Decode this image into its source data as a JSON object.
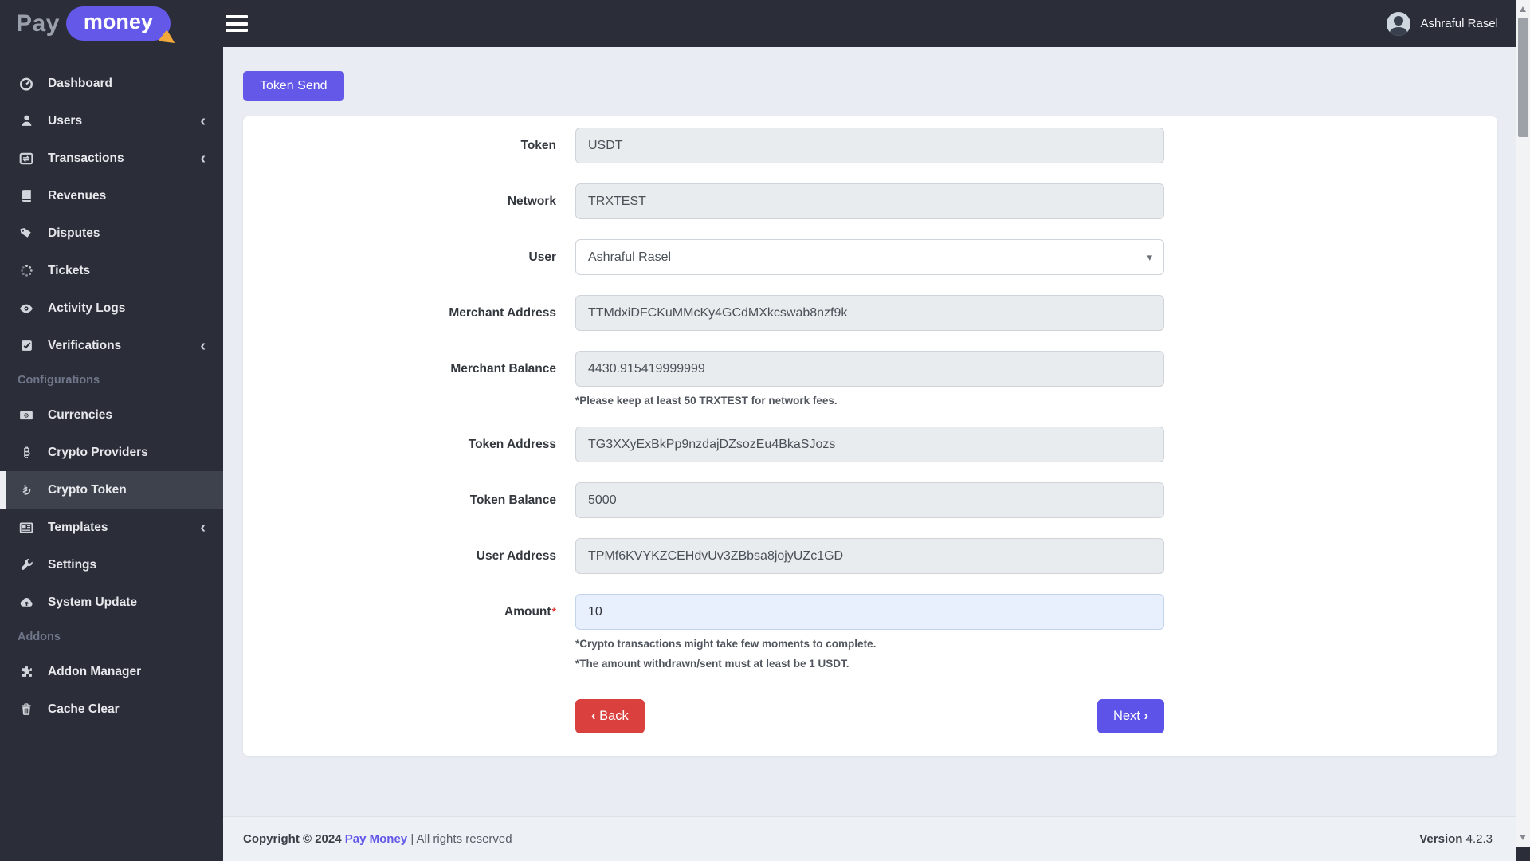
{
  "brand": {
    "pay": "Pay",
    "money": "money"
  },
  "topbar": {
    "user_name": "Ashraful Rasel"
  },
  "sidebar": {
    "chevron": "‹",
    "config_header": "Configurations",
    "addons_header": "Addons",
    "items": [
      {
        "label": "Dashboard"
      },
      {
        "label": "Users"
      },
      {
        "label": "Transactions"
      },
      {
        "label": "Revenues"
      },
      {
        "label": "Disputes"
      },
      {
        "label": "Tickets"
      },
      {
        "label": "Activity Logs"
      },
      {
        "label": "Verifications"
      },
      {
        "label": "Currencies"
      },
      {
        "label": "Crypto Providers"
      },
      {
        "label": "Crypto Token"
      },
      {
        "label": "Templates"
      },
      {
        "label": "Settings"
      },
      {
        "label": "System Update"
      },
      {
        "label": "Addon Manager"
      },
      {
        "label": "Cache Clear"
      }
    ]
  },
  "page": {
    "token_send_button": "Token Send",
    "select_caret": "▾",
    "required_mark": "*",
    "form": {
      "fields": [
        {
          "label": "Token",
          "value": "USDT"
        },
        {
          "label": "Network",
          "value": "TRXTEST"
        },
        {
          "label": "User",
          "value": "Ashraful Rasel"
        },
        {
          "label": "Merchant Address",
          "value": "TTMdxiDFCKuMMcKy4GCdMXkcswab8nzf9k"
        },
        {
          "label": "Merchant Balance",
          "value": "4430.915419999999",
          "note": "*Please keep at least 50 TRXTEST for network fees."
        },
        {
          "label": "Token Address",
          "value": "TG3XXyExBkPp9nzdajDZsozEu4BkaSJozs"
        },
        {
          "label": "Token Balance",
          "value": "5000"
        },
        {
          "label": "User Address",
          "value": "TPMf6KVYKZCEHdvUv3ZBbsa8jojyUZc1GD"
        },
        {
          "label": "Amount",
          "value": "10",
          "notes": [
            "*Crypto transactions might take few moments to complete.",
            "*The amount withdrawn/sent must at least be 1 USDT."
          ]
        }
      ]
    },
    "buttons": {
      "back_chevron": "‹",
      "back_label": "Back",
      "next_label": "Next",
      "next_chevron": "›"
    }
  },
  "footer": {
    "copyright_prefix": "Copyright © 2024",
    "brand_link": "Pay Money",
    "rights": "| All rights reserved",
    "version_label": "Version",
    "version_value": "4.2.3"
  },
  "colors": {
    "accent_purple": "#6358e8",
    "danger_red": "#d9403e",
    "dark_bg": "#2b2e38",
    "highlight_input_bg": "#e8f0fe"
  }
}
